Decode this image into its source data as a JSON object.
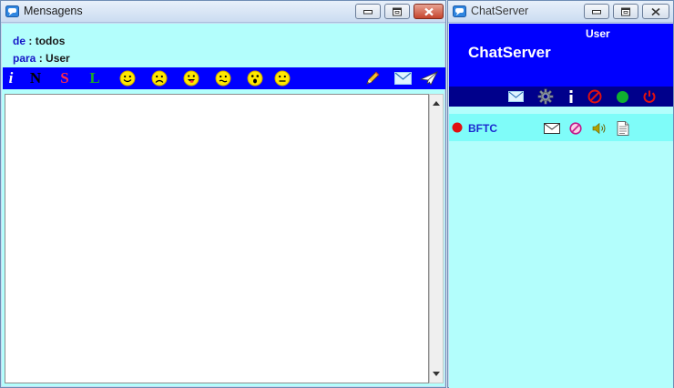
{
  "messages_window": {
    "title": "Mensagens",
    "from_label": "de",
    "from_value": "todos",
    "to_label": "para",
    "to_value": "User",
    "separator": ":",
    "format_buttons": {
      "info": "i",
      "normal": "N",
      "strike": "S",
      "light": "L"
    },
    "message_text": ""
  },
  "chat_window": {
    "title": "ChatServer",
    "user_label": "User",
    "brand": "ChatServer",
    "users": [
      {
        "name": "BFTC",
        "status": "offline"
      }
    ]
  },
  "colors": {
    "panel_bg": "#b3fefc",
    "toolbar_blue": "#0000ff",
    "toolbar_dark": "#00008b",
    "row_highlight": "#7ffcf9",
    "label_blue": "#1616c8",
    "status_offline": "#e01010",
    "status_online": "#10b030",
    "stop_red": "#e01010"
  }
}
